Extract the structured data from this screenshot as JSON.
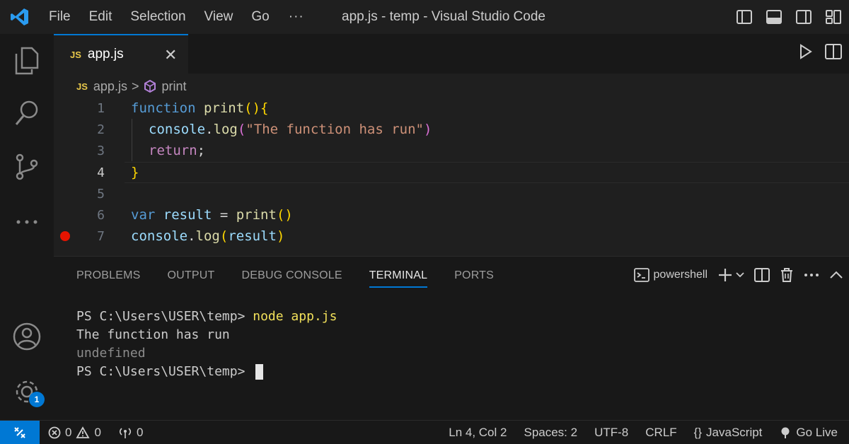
{
  "titlebar": {
    "menu": [
      "File",
      "Edit",
      "Selection",
      "View",
      "Go"
    ],
    "more": "···",
    "title": "app.js - temp - Visual Studio Code"
  },
  "activitybar": {
    "icons": [
      "explorer-icon",
      "search-icon",
      "source-control-icon",
      "more-icon",
      "account-icon",
      "settings-icon"
    ],
    "settings_badge": "1"
  },
  "tab": {
    "icon_text": "JS",
    "name": "app.js",
    "close": "✕"
  },
  "breadcrumb": {
    "icon_text": "JS",
    "file": "app.js",
    "separator": ">",
    "symbol": "print"
  },
  "editor": {
    "line_numbers": [
      "1",
      "2",
      "3",
      "4",
      "5",
      "6",
      "7"
    ],
    "active_line": 4,
    "breakpoint_line": 7,
    "lines": [
      {
        "t1": "function",
        "t2": " print",
        "t3": "()",
        "t4": "{"
      },
      {
        "t1": "console",
        "t2": ".",
        "t3": "log",
        "t4": "(",
        "t5": "\"The function has run\"",
        "t6": ")"
      },
      {
        "t1": "return",
        "t2": ";"
      },
      {
        "t1": "}"
      },
      {},
      {
        "t1": "var",
        "t2": " result",
        "t3": " = ",
        "t4": "print",
        "t5": "()"
      },
      {
        "t1": "console",
        "t2": ".",
        "t3": "log",
        "t4": "(",
        "t5": "result",
        "t6": ")"
      }
    ]
  },
  "panel": {
    "tabs": [
      "PROBLEMS",
      "OUTPUT",
      "DEBUG CONSOLE",
      "TERMINAL",
      "PORTS"
    ],
    "active_tab": "TERMINAL",
    "shell": "powershell",
    "terminal": {
      "prompt1": "PS C:\\Users\\USER\\temp> ",
      "command": "node app.js",
      "out1": "The function has run",
      "out2": "undefined",
      "prompt2": "PS C:\\Users\\USER\\temp> "
    }
  },
  "statusbar": {
    "errors": "0",
    "warnings": "0",
    "ports": "0",
    "position": "Ln 4, Col 2",
    "spaces": "Spaces: 2",
    "encoding": "UTF-8",
    "eol": "CRLF",
    "language": "JavaScript",
    "golive": "Go Live"
  },
  "colors": {
    "accent": "#0078d4",
    "breakpoint": "#e51400",
    "js_icon": "#e8c84a"
  }
}
